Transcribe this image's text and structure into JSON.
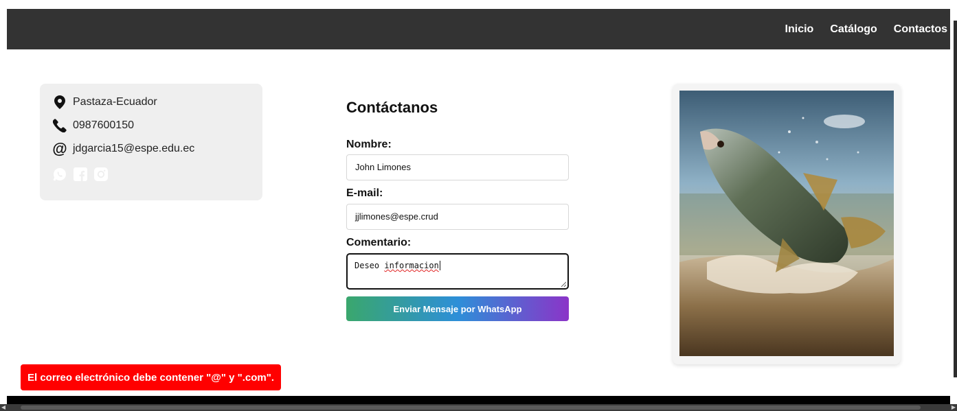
{
  "nav": {
    "links": [
      "Inicio",
      "Catálogo",
      "Contactos"
    ]
  },
  "info": {
    "location": "Pastaza-Ecuador",
    "phone": "0987600150",
    "email": "jdgarcia15@espe.edu.ec",
    "socials": [
      "whatsapp-icon",
      "facebook-icon",
      "instagram-icon"
    ]
  },
  "form": {
    "title": "Contáctanos",
    "nombre_label": "Nombre:",
    "nombre_value": "John Limones",
    "email_label": "E-mail:",
    "email_value": "jjlimones@espe.crud",
    "comentario_label": "Comentario:",
    "comentario_word1": "Deseo",
    "comentario_word2": "informacion",
    "submit_label": "Enviar Mensaje por WhatsApp"
  },
  "toast": {
    "message": "El correo electrónico debe contener \"@\" y \".com\"."
  },
  "colors": {
    "navbar": "#333333",
    "toast": "#ff0000",
    "button_gradient": [
      "#3aa76d",
      "#2d8fd8",
      "#8b34c8"
    ]
  }
}
